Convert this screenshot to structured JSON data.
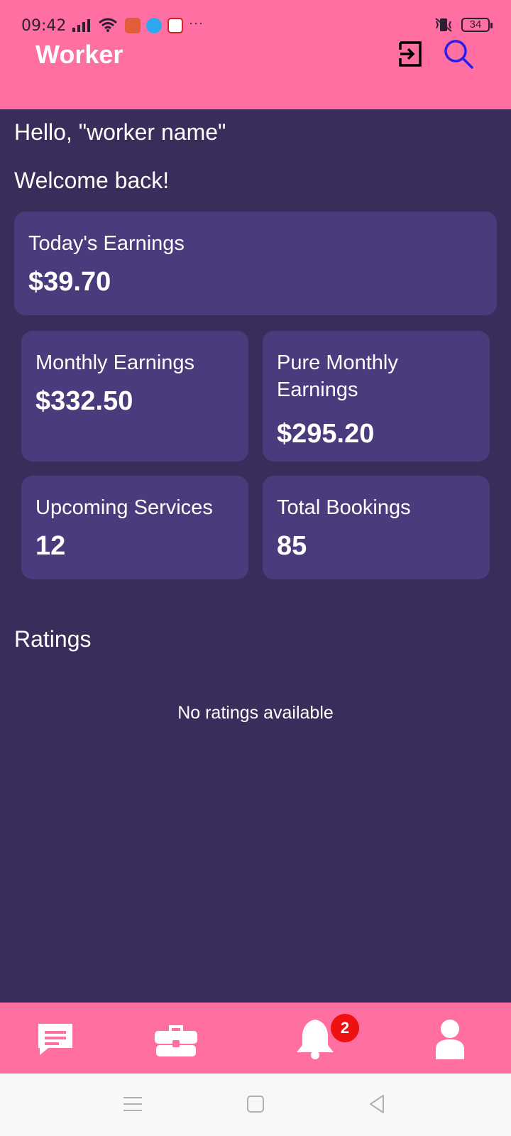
{
  "status_bar": {
    "time": "09:42",
    "battery": "34",
    "more": "···",
    "icons": [
      "signal-icon",
      "wifi-icon",
      "music-app-icon",
      "chat-app-icon",
      "news-app-icon",
      "vibrate-icon",
      "battery-icon"
    ]
  },
  "app_bar": {
    "title": "Worker",
    "actions": [
      "logout-icon",
      "search-icon"
    ],
    "bg_color": "#ff6fa2",
    "search_color": "#2a1ee6"
  },
  "greeting": {
    "hello": "Hello, \"worker name\"",
    "welcome": "Welcome back!"
  },
  "stats": {
    "today": {
      "label": "Today's Earnings",
      "value": "$39.70"
    },
    "monthly": {
      "label": "Monthly Earnings",
      "value": "$332.50"
    },
    "pure_monthly": {
      "label": "Pure Monthly Earnings",
      "value": "$295.20"
    },
    "upcoming": {
      "label": "Upcoming Services",
      "value": "12"
    },
    "bookings": {
      "label": "Total Bookings",
      "value": "85"
    }
  },
  "ratings": {
    "title": "Ratings",
    "empty_text": "No ratings available"
  },
  "bottom_nav": {
    "items": [
      "chat-icon",
      "briefcase-icon",
      "bell-icon",
      "profile-icon"
    ],
    "notification_count": "2"
  },
  "system_nav": [
    "menu-icon",
    "home-icon",
    "back-icon"
  ],
  "colors": {
    "background": "#3a2d5c",
    "card": "#4a3b7c",
    "accent": "#ff6fa2",
    "badge": "#ee1111"
  }
}
